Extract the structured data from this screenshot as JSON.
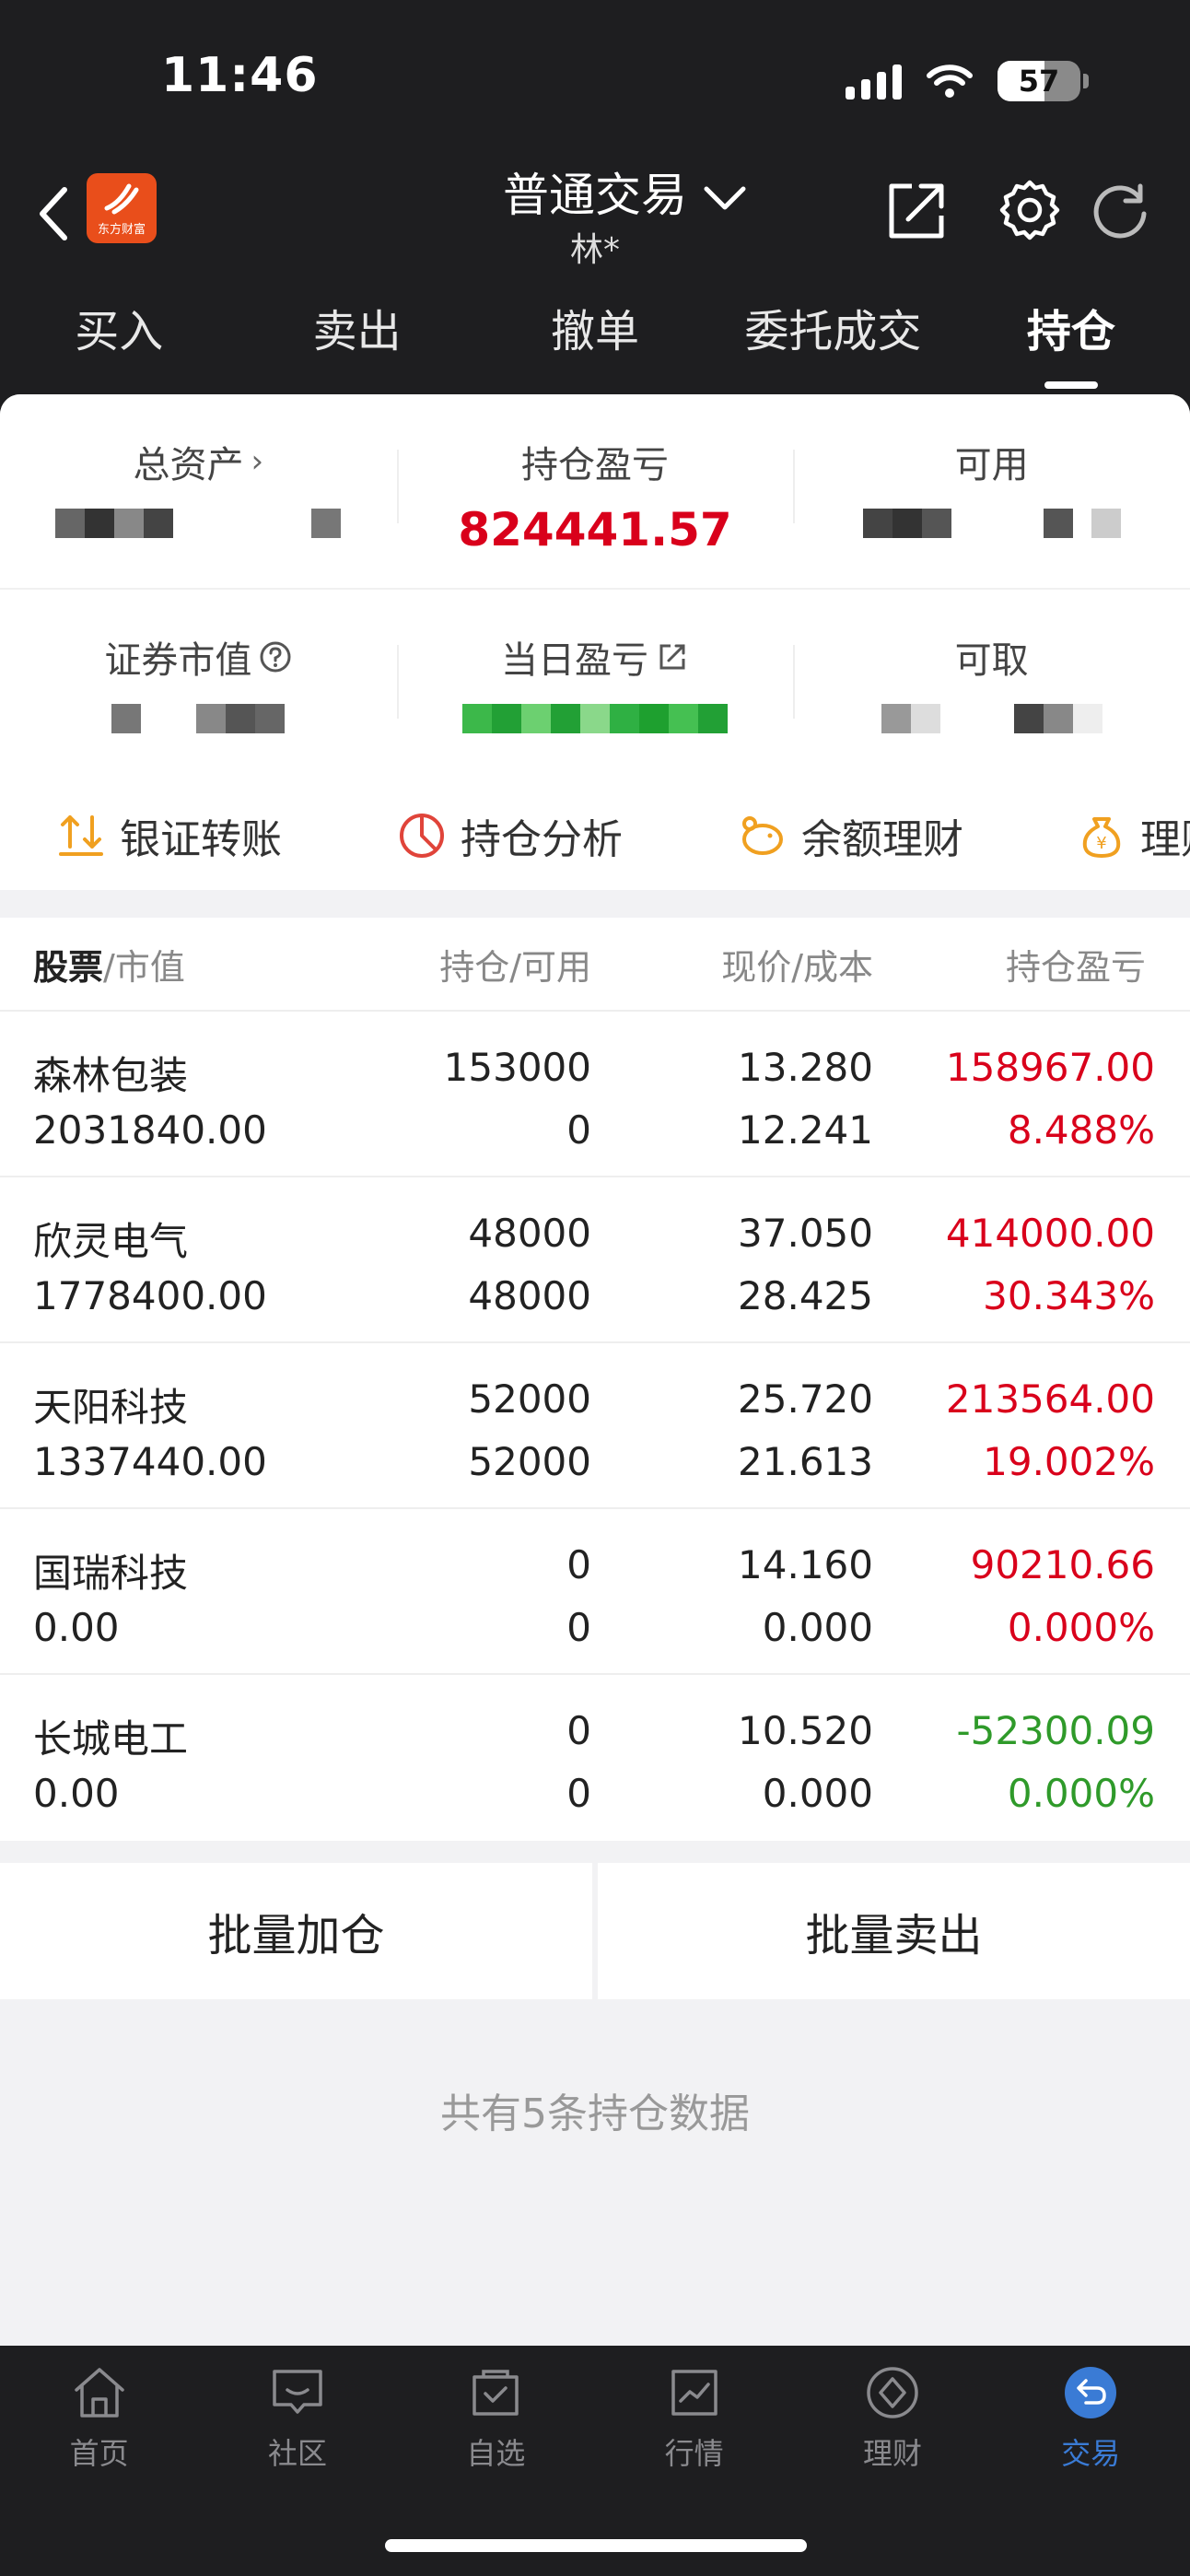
{
  "status_bar": {
    "time": "11:46",
    "battery": "57"
  },
  "header": {
    "title": "普通交易",
    "subtitle": "林*",
    "logo_text": "东方财富"
  },
  "tabs": [
    {
      "label": "买入",
      "active": false
    },
    {
      "label": "卖出",
      "active": false
    },
    {
      "label": "撤单",
      "active": false
    },
    {
      "label": "委托成交",
      "active": false
    },
    {
      "label": "持仓",
      "active": true
    }
  ],
  "summary": {
    "total_assets_label": "总资产",
    "position_pnl_label": "持仓盈亏",
    "position_pnl_value": "824441.57",
    "available_label": "可用",
    "market_value_label": "证券市值",
    "daily_pnl_label": "当日盈亏",
    "withdrawable_label": "可取"
  },
  "quick_actions": [
    {
      "label": "银证转账",
      "icon": "transfer-icon"
    },
    {
      "label": "持仓分析",
      "icon": "pie-chart-icon"
    },
    {
      "label": "余额理财",
      "icon": "piggy-bank-icon"
    },
    {
      "label": "理财",
      "icon": "money-bag-icon"
    }
  ],
  "table": {
    "headers": {
      "stock": "股票",
      "market_value": "/市值",
      "hold": "持仓/可用",
      "price": "现价/成本",
      "pnl": "持仓盈亏"
    },
    "rows": [
      {
        "name": "森林包装",
        "market_value": "2031840.00",
        "hold": "153000",
        "avail": "0",
        "price": "13.280",
        "cost": "12.241",
        "pnl": "158967.00",
        "pct": "8.488%",
        "tone": "red"
      },
      {
        "name": "欣灵电气",
        "market_value": "1778400.00",
        "hold": "48000",
        "avail": "48000",
        "price": "37.050",
        "cost": "28.425",
        "pnl": "414000.00",
        "pct": "30.343%",
        "tone": "red"
      },
      {
        "name": "天阳科技",
        "market_value": "1337440.00",
        "hold": "52000",
        "avail": "52000",
        "price": "25.720",
        "cost": "21.613",
        "pnl": "213564.00",
        "pct": "19.002%",
        "tone": "red"
      },
      {
        "name": "国瑞科技",
        "market_value": "0.00",
        "hold": "0",
        "avail": "0",
        "price": "14.160",
        "cost": "0.000",
        "pnl": "90210.66",
        "pct": "0.000%",
        "tone": "red"
      },
      {
        "name": "长城电工",
        "market_value": "0.00",
        "hold": "0",
        "avail": "0",
        "price": "10.520",
        "cost": "0.000",
        "pnl": "-52300.09",
        "pct": "0.000%",
        "tone": "green"
      }
    ]
  },
  "bulk": {
    "add_label": "批量加仓",
    "sell_label": "批量卖出"
  },
  "footer_note": "共有5条持仓数据",
  "bottom_nav": [
    {
      "label": "首页",
      "icon": "home-icon",
      "active": false
    },
    {
      "label": "社区",
      "icon": "community-icon",
      "active": false
    },
    {
      "label": "自选",
      "icon": "watchlist-icon",
      "active": false
    },
    {
      "label": "行情",
      "icon": "market-icon",
      "active": false
    },
    {
      "label": "理财",
      "icon": "wealth-icon",
      "active": false
    },
    {
      "label": "交易",
      "icon": "trade-icon",
      "active": true
    }
  ],
  "colors": {
    "profit": "#d9001b",
    "loss": "#2f9a2a",
    "accent": "#3a7bd5",
    "header_bg": "#1e1e20"
  }
}
